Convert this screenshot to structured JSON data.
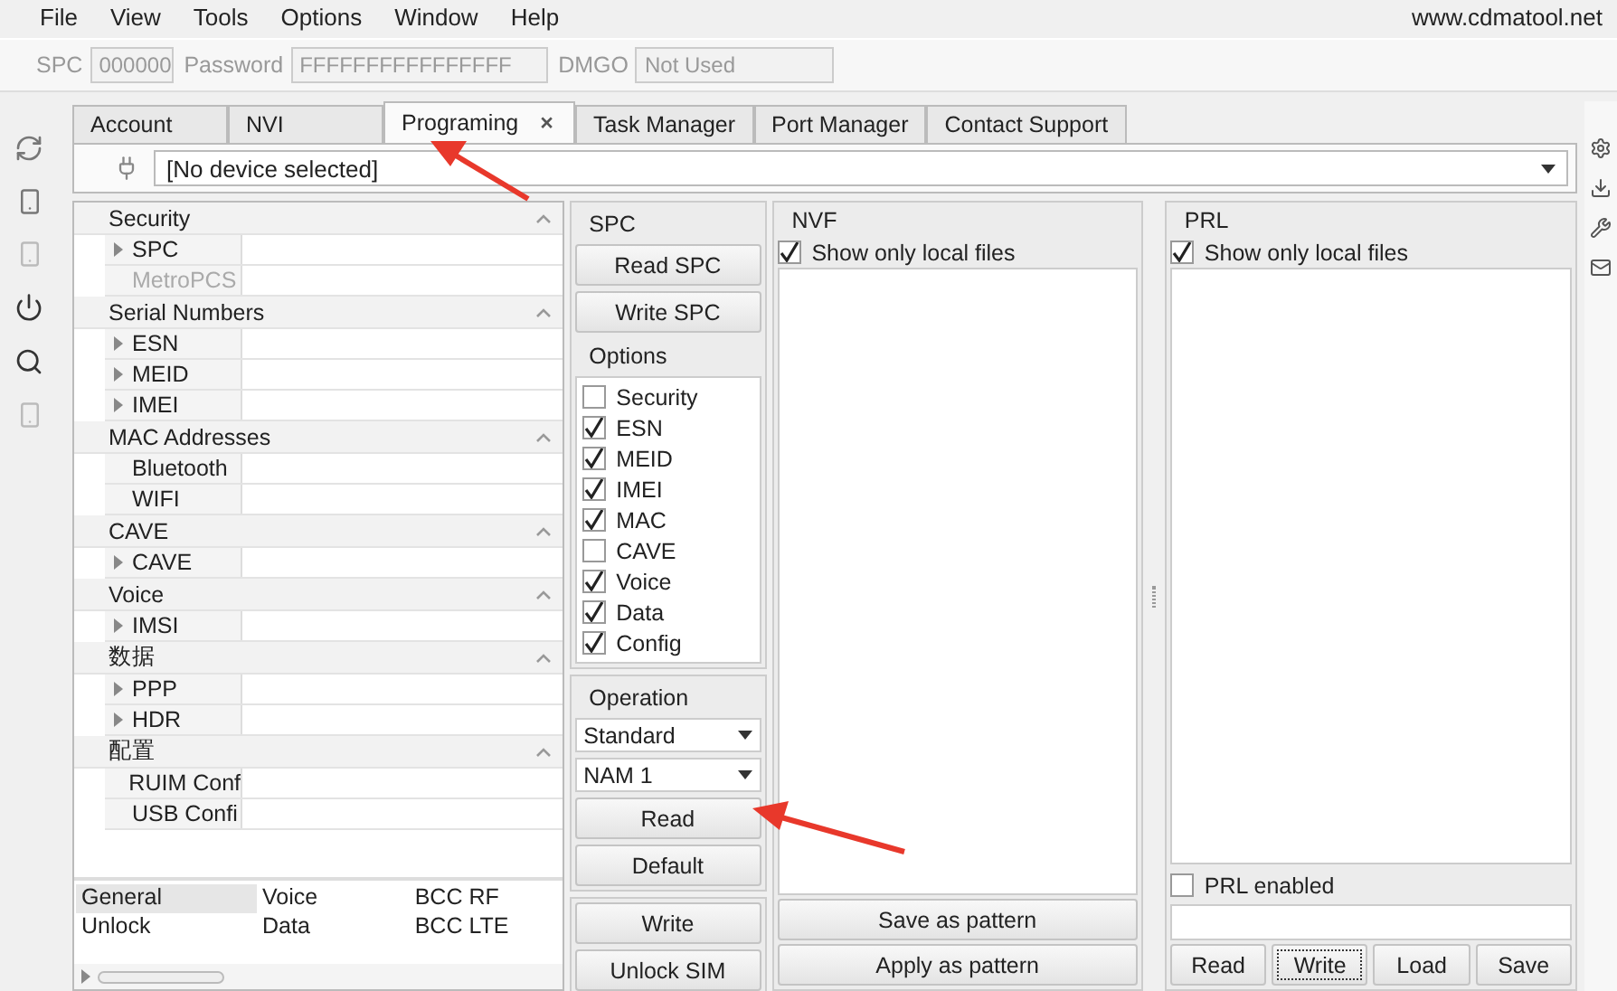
{
  "menu": {
    "items": [
      "File",
      "View",
      "Tools",
      "Options",
      "Window",
      "Help"
    ],
    "site": "www.cdmatool.net"
  },
  "toolbar": [
    {
      "label": "SPC",
      "value": "000000",
      "disabled": true
    },
    {
      "label": "Password",
      "value": "FFFFFFFFFFFFFFFF",
      "disabled": true
    },
    {
      "label": "DMGO",
      "value": "Not Used",
      "disabled": true
    }
  ],
  "tabs": [
    {
      "label": "Account",
      "selected": false
    },
    {
      "label": "NVI",
      "selected": false
    },
    {
      "label": "Programing",
      "selected": true,
      "close": "×"
    },
    {
      "label": "Task Manager",
      "selected": false
    },
    {
      "label": "Port Manager",
      "selected": false
    },
    {
      "label": "Contact Support",
      "selected": false
    }
  ],
  "device": {
    "value": "[No device selected]"
  },
  "sections": [
    {
      "title": "Security",
      "rows": [
        {
          "label": "SPC",
          "expandable": true,
          "disabled": false
        },
        {
          "label": "MetroPCS",
          "expandable": false,
          "disabled": true
        }
      ]
    },
    {
      "title": "Serial Numbers",
      "rows": [
        {
          "label": "ESN",
          "expandable": true,
          "disabled": false
        },
        {
          "label": "MEID",
          "expandable": true,
          "disabled": false
        },
        {
          "label": "IMEI",
          "expandable": true,
          "disabled": false
        }
      ]
    },
    {
      "title": "MAC Addresses",
      "rows": [
        {
          "label": "Bluetooth",
          "expandable": false,
          "disabled": false
        },
        {
          "label": "WIFI",
          "expandable": false,
          "disabled": false
        }
      ]
    },
    {
      "title": "CAVE",
      "rows": [
        {
          "label": "CAVE",
          "expandable": true,
          "disabled": false
        }
      ]
    },
    {
      "title": "Voice",
      "rows": [
        {
          "label": "IMSI",
          "expandable": true,
          "disabled": false
        }
      ]
    },
    {
      "title": "数据",
      "rows": [
        {
          "label": "PPP",
          "expandable": true,
          "disabled": false
        },
        {
          "label": "HDR",
          "expandable": true,
          "disabled": false
        }
      ]
    },
    {
      "title": "配置",
      "rows": [
        {
          "label": "RUIM Conf",
          "expandable": false,
          "disabled": false
        },
        {
          "label": "USB Confi",
          "expandable": false,
          "disabled": false
        }
      ]
    }
  ],
  "categories": [
    [
      {
        "label": "General",
        "selected": true
      },
      {
        "label": "Unlock",
        "selected": false
      }
    ],
    [
      {
        "label": "Voice",
        "selected": false
      },
      {
        "label": "Data",
        "selected": false
      }
    ],
    [
      {
        "label": "BCC RF",
        "selected": false
      },
      {
        "label": "BCC LTE",
        "selected": false
      }
    ]
  ],
  "spc": {
    "title": "SPC",
    "buttons": [
      "Read SPC",
      "Write SPC"
    ]
  },
  "options": {
    "title": "Options",
    "items": [
      {
        "label": "Security",
        "checked": false
      },
      {
        "label": "ESN",
        "checked": true
      },
      {
        "label": "MEID",
        "checked": true
      },
      {
        "label": "IMEI",
        "checked": true
      },
      {
        "label": "MAC",
        "checked": true
      },
      {
        "label": "CAVE",
        "checked": false
      },
      {
        "label": "Voice",
        "checked": true
      },
      {
        "label": "Data",
        "checked": true
      },
      {
        "label": "Config",
        "checked": true
      }
    ]
  },
  "operation": {
    "title": "Operation",
    "selects": [
      "Standard",
      "NAM 1"
    ],
    "buttons": [
      "Read",
      "Default"
    ]
  },
  "actions": [
    "Write",
    "Unlock SIM"
  ],
  "nvf": {
    "title": "NVF",
    "local": {
      "label": "Show only local files",
      "checked": true
    },
    "buttons": [
      "Save as pattern",
      "Apply as pattern"
    ]
  },
  "prl": {
    "title": "PRL",
    "local": {
      "label": "Show only local files",
      "checked": true
    },
    "enabled": {
      "label": "PRL enabled",
      "checked": false
    },
    "buttons": [
      {
        "label": "Read",
        "focused": false
      },
      {
        "label": "Write",
        "focused": true
      },
      {
        "label": "Load",
        "focused": false
      },
      {
        "label": "Save",
        "focused": false
      }
    ]
  }
}
